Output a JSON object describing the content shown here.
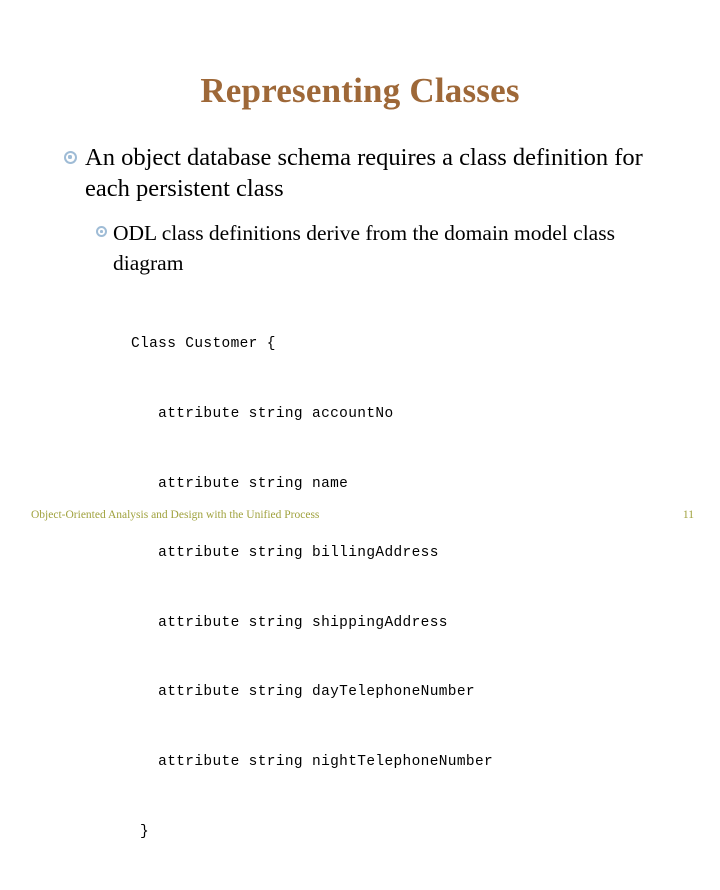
{
  "slide": {
    "title": "Representing Classes",
    "title_color": "#9e6838",
    "background_color": "#ffffff",
    "bullet_color": "#9fbcd6",
    "body_text_color": "#000000"
  },
  "bullets": [
    {
      "level": 1,
      "glyph": "target-bullet",
      "text": "An object database schema requires a class definition for each persistent class"
    },
    {
      "level": 2,
      "glyph": "target-bullet",
      "text": "ODL class definitions derive from the domain model class diagram"
    }
  ],
  "code": {
    "language": "odl",
    "lines": [
      "Class Customer {",
      "   attribute string accountNo",
      "   attribute string name",
      "   attribute string billingAddress",
      "   attribute string shippingAddress",
      "   attribute string dayTelephoneNumber",
      "   attribute string nightTelephoneNumber",
      " }"
    ]
  },
  "footer": {
    "text": "Object-Oriented Analysis and Design with the Unified Process",
    "page_number": "11",
    "color": "#a0a23e"
  }
}
